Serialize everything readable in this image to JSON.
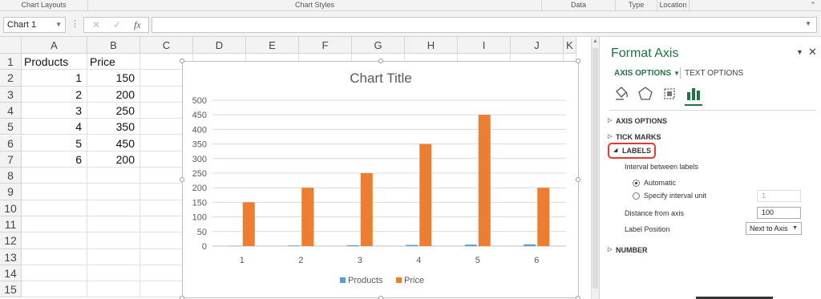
{
  "ribbon": {
    "groups": [
      "Chart Layouts",
      "Chart Styles",
      "Data",
      "Type",
      "Location"
    ]
  },
  "formula_bar": {
    "name_box": "Chart 1",
    "cancel_icon": "✕",
    "enter_icon": "✓",
    "fx_icon": "fx",
    "formula": ""
  },
  "sheet": {
    "columns": [
      "A",
      "B",
      "C",
      "D",
      "E",
      "F",
      "G",
      "H",
      "I",
      "J",
      "K"
    ],
    "rows": [
      "1",
      "2",
      "3",
      "4",
      "5",
      "6",
      "7",
      "8",
      "9",
      "10",
      "11",
      "12",
      "13",
      "14",
      "15"
    ],
    "header": [
      "Products",
      "Price"
    ],
    "data": [
      [
        "1",
        "150"
      ],
      [
        "2",
        "200"
      ],
      [
        "3",
        "250"
      ],
      [
        "4",
        "350"
      ],
      [
        "5",
        "450"
      ],
      [
        "6",
        "200"
      ]
    ]
  },
  "chart_data": {
    "type": "bar",
    "title": "Chart Title",
    "categories": [
      "1",
      "2",
      "3",
      "4",
      "5",
      "6"
    ],
    "series": [
      {
        "name": "Products",
        "values": [
          1,
          2,
          3,
          4,
          5,
          6
        ],
        "color": "#5b9bd5"
      },
      {
        "name": "Price",
        "values": [
          150,
          200,
          250,
          350,
          450,
          200
        ],
        "color": "#ed7d31"
      }
    ],
    "ylim": [
      0,
      500
    ],
    "yticks": [
      "0",
      "50",
      "100",
      "150",
      "200",
      "250",
      "300",
      "350",
      "400",
      "450",
      "500"
    ],
    "grid": true,
    "legend": "bottom"
  },
  "format_pane": {
    "title": "Format Axis",
    "tab_axis_options": "AXIS OPTIONS",
    "tab_text_options": "TEXT OPTIONS",
    "icons": [
      "fill-line-icon",
      "effects-icon",
      "size-properties-icon",
      "axis-options-icon"
    ],
    "sections": {
      "axis_options": "AXIS OPTIONS",
      "tick_marks": "TICK MARKS",
      "labels": "LABELS",
      "number": "NUMBER"
    },
    "interval_label": "Interval between labels",
    "automatic": "Automatic",
    "specify": "Specify interval unit",
    "interval_value": "1",
    "distance_label": "Distance from axis",
    "distance_value": "100",
    "position_label": "Label Position",
    "position_value": "Next to Axis"
  }
}
